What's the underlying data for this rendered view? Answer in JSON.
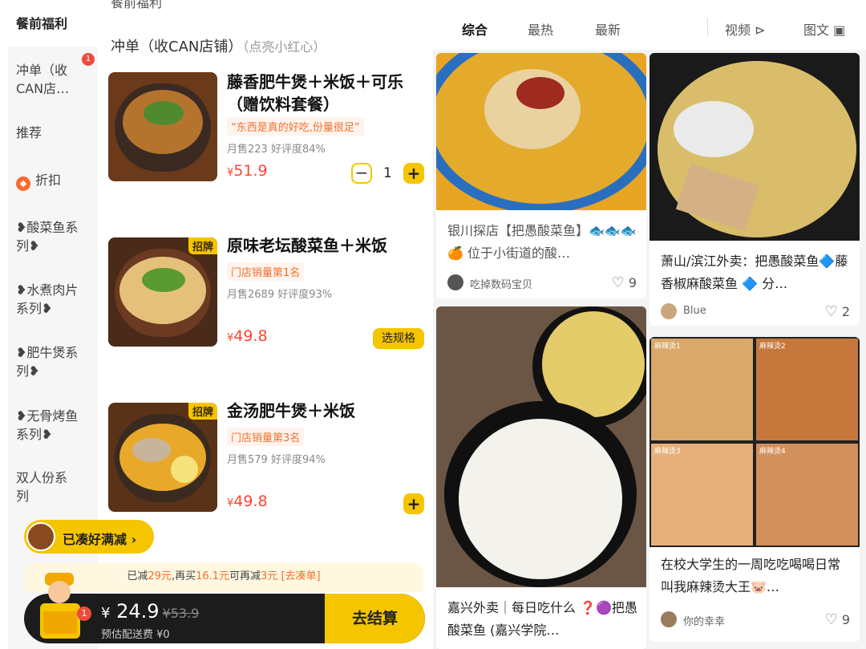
{
  "left": {
    "cut_title": "餐前福利",
    "section": {
      "title": "冲单（收CAN店铺）",
      "subtitle": "（点亮小红心）"
    },
    "sidebar": {
      "items": [
        {
          "label": "餐前福利"
        },
        {
          "label": "冲单（收CAN店…",
          "badge": "1"
        },
        {
          "label": "推荐"
        },
        {
          "label": "折扣",
          "icon": "discount-icon"
        },
        {
          "label": "❥酸菜鱼系列❥"
        },
        {
          "label": "❥水煮肉片系列❥"
        },
        {
          "label": "❥肥牛煲系列❥"
        },
        {
          "label": "❥无骨烤鱼系列❥"
        },
        {
          "label": "双人份系列"
        }
      ]
    },
    "dishes": [
      {
        "name": "藤香肥牛煲＋米饭＋可乐（赠饮料套餐）",
        "promo": "“东西是真的好吃,份量很足”",
        "stats": "月售223  好评度84%",
        "price_symbol": "¥",
        "price": "51.9",
        "qty": "1"
      },
      {
        "badge": "招牌",
        "name": "原味老坛酸菜鱼＋米饭",
        "promo": "门店销量第1名",
        "stats": "月售2689  好评度93%",
        "price_symbol": "¥",
        "price": "49.8",
        "spec_label": "选规格"
      },
      {
        "badge": "招牌",
        "name": "金汤肥牛煲＋米饭",
        "promo": "门店销量第3名",
        "stats": "月售579  好评度94%",
        "price_symbol": "¥",
        "price": "49.8"
      }
    ],
    "fav_pill": "已凑好满减 ›",
    "promo_strip": {
      "p1": "已减",
      "v1": "29元",
      "p2": ",再买",
      "v2": "16.1元",
      "p3": "可再减",
      "v3": "3元",
      "p4": " [去凑单]"
    },
    "cart": {
      "yen": "¥",
      "price": "24.9",
      "old_price": "¥53.9",
      "shipping": "预估配送费 ¥0",
      "badge": "1",
      "checkout": "去结算"
    }
  },
  "right": {
    "tabs": [
      {
        "label": "综合"
      },
      {
        "label": "最热"
      },
      {
        "label": "最新"
      },
      {
        "label": "视频 ⊳"
      },
      {
        "label": "图文 ▣"
      }
    ],
    "cards": [
      {
        "title": "银川探店【把愚酸菜鱼】🐟🐟🐟🍊 位于小街道的酸…",
        "author": "吃掉数码宝贝",
        "likes": "9"
      },
      {
        "title": "萧山/滨江外卖：把愚酸菜鱼🔷藤香椒麻酸菜鱼 🔷 分…",
        "author": "Blue",
        "likes": "2"
      },
      {
        "title": "嘉兴外卖｜每日吃什么 ❓🟣把愚酸菜鱼 (嘉兴学院…",
        "author": "",
        "likes": ""
      },
      {
        "title": "在校大学生的一周吃吃喝喝日常 叫我麻辣烫大王🐷…",
        "author": "你的幸幸",
        "likes": "9"
      }
    ],
    "collage_labels": [
      "麻辣烫1",
      "麻辣烫2",
      "麻辣烫3",
      "麻辣烫4"
    ]
  },
  "colors": {
    "accent_yellow": "#f5c500",
    "price_red": "#ff4433",
    "promo_orange": "#f07030"
  }
}
